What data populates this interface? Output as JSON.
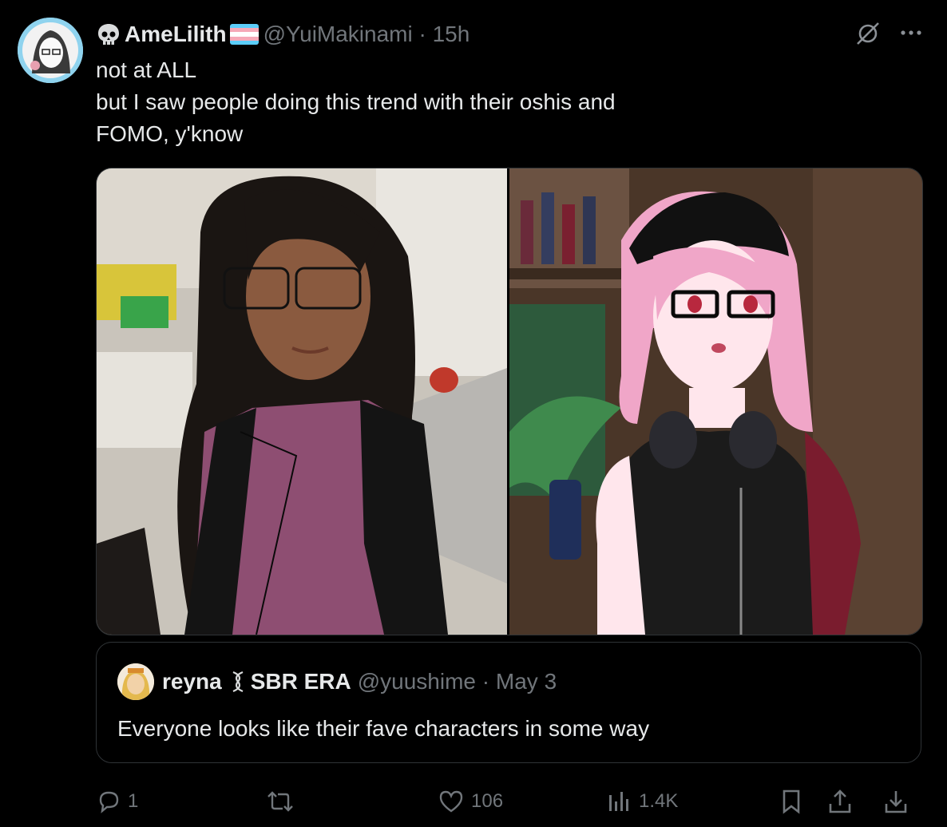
{
  "author": {
    "display_name": "AmeLilith",
    "handle": "@YuiMakinami",
    "time": "15h",
    "flag_colors": [
      "#5bcefa",
      "#f5a9b8",
      "#ffffff",
      "#f5a9b8",
      "#5bcefa"
    ]
  },
  "post": {
    "lines": [
      "not at ALL",
      "but I saw people doing this trend with their oshis and",
      "FOMO, y'know"
    ]
  },
  "quote": {
    "name": "reyna",
    "name_suffix": "SBR ERA",
    "handle": "@yuushime",
    "date": "May 3",
    "text": "Everyone looks like their fave characters in some way"
  },
  "actions": {
    "replies": "1",
    "likes": "106",
    "views": "1.4K"
  },
  "colors": {
    "background": "#000000",
    "text_primary": "#e7e9ea",
    "text_secondary": "#71767b",
    "border": "#2f3336"
  },
  "icons": [
    "skull-icon",
    "mute-icon",
    "more-icon",
    "reply-icon",
    "repost-icon",
    "like-icon",
    "views-icon",
    "bookmark-icon",
    "share-icon",
    "download-icon"
  ]
}
